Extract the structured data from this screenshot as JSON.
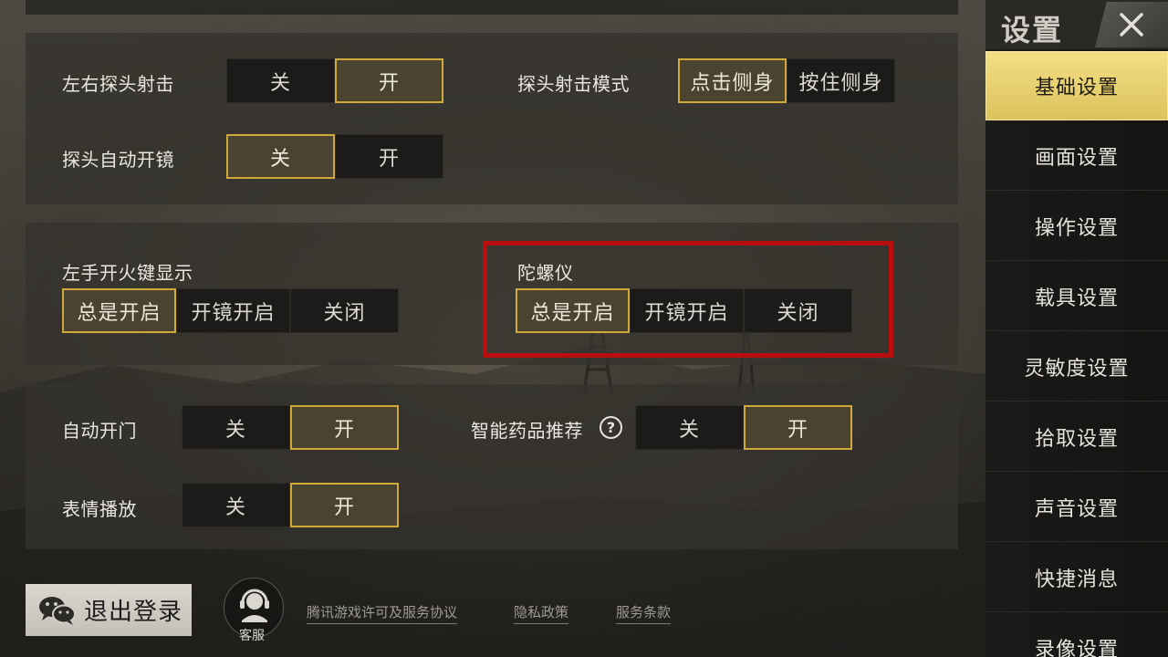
{
  "panel1": {
    "lean_fire": {
      "label": "左右探头射击",
      "options": [
        "关",
        "开"
      ],
      "selected": 1
    },
    "lean_mode": {
      "label": "探头射击模式",
      "options": [
        "点击侧身",
        "按住侧身"
      ],
      "selected": 0
    },
    "lean_auto_scope": {
      "label": "探头自动开镜",
      "options": [
        "关",
        "开"
      ],
      "selected": 0
    }
  },
  "panel2": {
    "left_fire": {
      "label": "左手开火键显示",
      "options": [
        "总是开启",
        "开镜开启",
        "关闭"
      ],
      "selected": 0
    },
    "gyro": {
      "label": "陀螺仪",
      "options": [
        "总是开启",
        "开镜开启",
        "关闭"
      ],
      "selected": 0
    }
  },
  "panel3": {
    "auto_door": {
      "label": "自动开门",
      "options": [
        "关",
        "开"
      ],
      "selected": 1
    },
    "smart_meds": {
      "label": "智能药品推荐",
      "help": "?",
      "options": [
        "关",
        "开"
      ],
      "selected": 1
    },
    "emote": {
      "label": "表情播放",
      "options": [
        "关",
        "开"
      ],
      "selected": 1
    }
  },
  "footer": {
    "logout": "退出登录",
    "service": "客服",
    "links": [
      "腾讯游戏许可及服务协议",
      "隐私政策",
      "服务条款"
    ]
  },
  "sidebar": {
    "title": "设置",
    "items": [
      "基础设置",
      "画面设置",
      "操作设置",
      "载具设置",
      "灵敏度设置",
      "拾取设置",
      "声音设置",
      "快捷消息",
      "录像设置"
    ],
    "active": 0
  },
  "colors": {
    "accent": "#cfa93a",
    "highlight_box": "#b80e10",
    "active_tab": "#e8cf6e"
  }
}
